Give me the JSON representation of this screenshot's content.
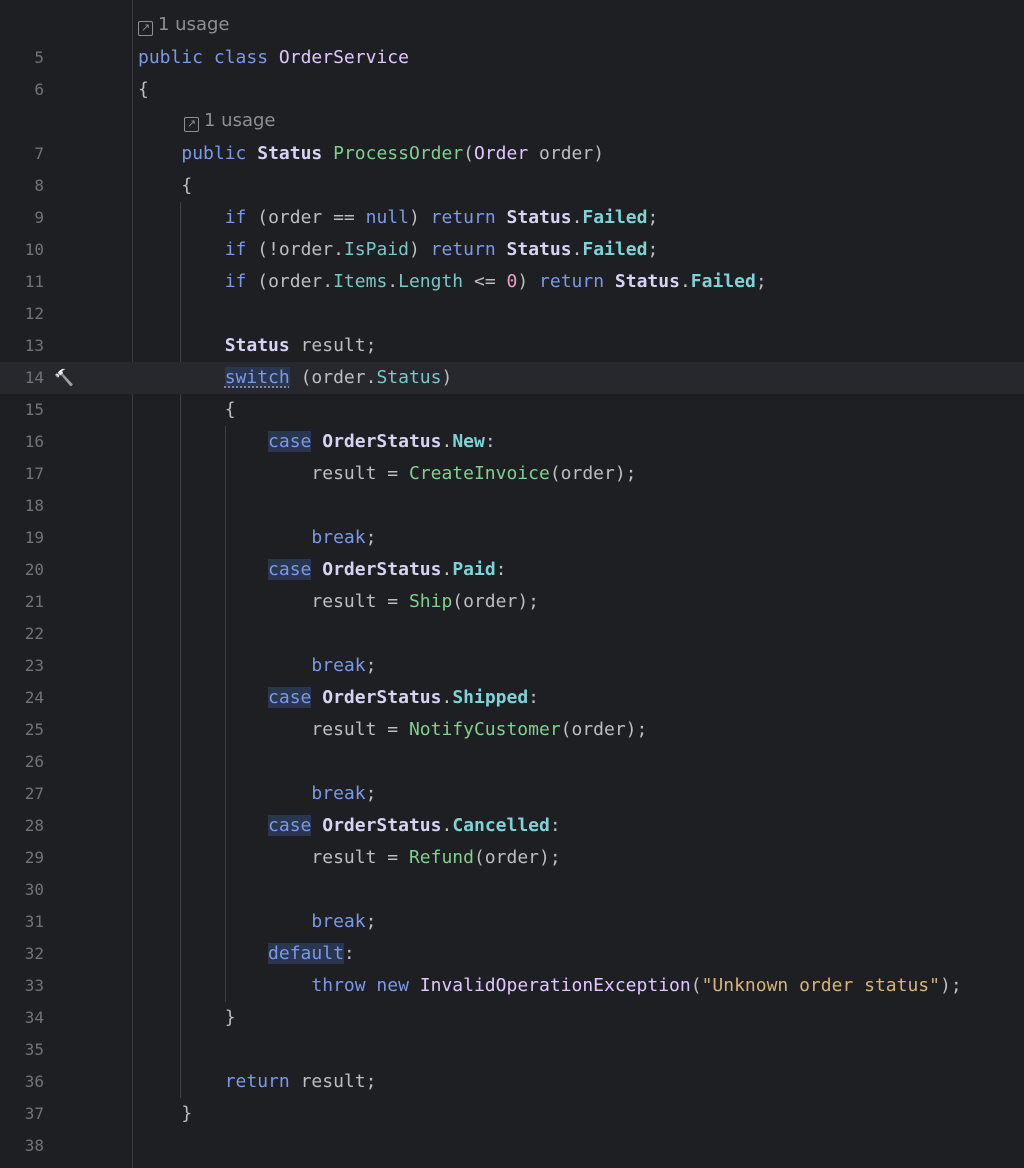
{
  "editor": {
    "usage_hints": [
      "1 usage",
      "1 usage"
    ],
    "gutter_icon": "hammer-icon",
    "lines": [
      {
        "n": "5",
        "tokens": [
          [
            "kw",
            "public"
          ],
          [
            "p",
            " "
          ],
          [
            "kw",
            "class"
          ],
          [
            "p",
            " "
          ],
          [
            "cls",
            "OrderService"
          ]
        ]
      },
      {
        "n": "6",
        "tokens": [
          [
            "p",
            "{"
          ]
        ]
      },
      {
        "n": "7",
        "tokens": [
          [
            "p",
            "    "
          ],
          [
            "kw",
            "public"
          ],
          [
            "p",
            " "
          ],
          [
            "typ",
            "Status"
          ],
          [
            "p",
            " "
          ],
          [
            "mfn",
            "ProcessOrder"
          ],
          [
            "p",
            "("
          ],
          [
            "cls",
            "Order"
          ],
          [
            "p",
            " order)"
          ]
        ]
      },
      {
        "n": "8",
        "tokens": [
          [
            "p",
            "    {"
          ]
        ]
      },
      {
        "n": "9",
        "tokens": [
          [
            "p",
            "        "
          ],
          [
            "kw",
            "if"
          ],
          [
            "p",
            " (order == "
          ],
          [
            "kw",
            "null"
          ],
          [
            "p",
            ") "
          ],
          [
            "kw",
            "return"
          ],
          [
            "p",
            " "
          ],
          [
            "typ",
            "Status"
          ],
          [
            "p",
            "."
          ],
          [
            "enm",
            "Failed"
          ],
          [
            "p",
            ";"
          ]
        ]
      },
      {
        "n": "10",
        "tokens": [
          [
            "p",
            "        "
          ],
          [
            "kw",
            "if"
          ],
          [
            "p",
            " (!order."
          ],
          [
            "prop",
            "IsPaid"
          ],
          [
            "p",
            ") "
          ],
          [
            "kw",
            "return"
          ],
          [
            "p",
            " "
          ],
          [
            "typ",
            "Status"
          ],
          [
            "p",
            "."
          ],
          [
            "enm",
            "Failed"
          ],
          [
            "p",
            ";"
          ]
        ]
      },
      {
        "n": "11",
        "tokens": [
          [
            "p",
            "        "
          ],
          [
            "kw",
            "if"
          ],
          [
            "p",
            " (order."
          ],
          [
            "prop",
            "Items"
          ],
          [
            "p",
            "."
          ],
          [
            "prop",
            "Length"
          ],
          [
            "p",
            " <= "
          ],
          [
            "num",
            "0"
          ],
          [
            "p",
            ") "
          ],
          [
            "kw",
            "return"
          ],
          [
            "p",
            " "
          ],
          [
            "typ",
            "Status"
          ],
          [
            "p",
            "."
          ],
          [
            "enm",
            "Failed"
          ],
          [
            "p",
            ";"
          ]
        ]
      },
      {
        "n": "12",
        "tokens": []
      },
      {
        "n": "13",
        "tokens": [
          [
            "p",
            "        "
          ],
          [
            "typ",
            "Status"
          ],
          [
            "p",
            " result;"
          ]
        ]
      },
      {
        "n": "14",
        "tokens": [
          [
            "p",
            "        "
          ],
          [
            "sw kw",
            "switch"
          ],
          [
            "p",
            " (order."
          ],
          [
            "prop",
            "Status"
          ],
          [
            "p",
            ")"
          ]
        ]
      },
      {
        "n": "15",
        "tokens": [
          [
            "p",
            "        {"
          ]
        ]
      },
      {
        "n": "16",
        "tokens": [
          [
            "p",
            "            "
          ],
          [
            "casebg kw",
            "case"
          ],
          [
            "p",
            " "
          ],
          [
            "typ",
            "OrderStatus"
          ],
          [
            "p",
            "."
          ],
          [
            "enm",
            "New"
          ],
          [
            "p",
            ":"
          ]
        ]
      },
      {
        "n": "17",
        "tokens": [
          [
            "p",
            "                result = "
          ],
          [
            "mfn",
            "CreateInvoice"
          ],
          [
            "p",
            "(order);"
          ]
        ]
      },
      {
        "n": "18",
        "tokens": []
      },
      {
        "n": "19",
        "tokens": [
          [
            "p",
            "                "
          ],
          [
            "kw",
            "break"
          ],
          [
            "p",
            ";"
          ]
        ]
      },
      {
        "n": "20",
        "tokens": [
          [
            "p",
            "            "
          ],
          [
            "casebg kw",
            "case"
          ],
          [
            "p",
            " "
          ],
          [
            "typ",
            "OrderStatus"
          ],
          [
            "p",
            "."
          ],
          [
            "enm",
            "Paid"
          ],
          [
            "p",
            ":"
          ]
        ]
      },
      {
        "n": "21",
        "tokens": [
          [
            "p",
            "                result = "
          ],
          [
            "mfn",
            "Ship"
          ],
          [
            "p",
            "(order);"
          ]
        ]
      },
      {
        "n": "22",
        "tokens": []
      },
      {
        "n": "23",
        "tokens": [
          [
            "p",
            "                "
          ],
          [
            "kw",
            "break"
          ],
          [
            "p",
            ";"
          ]
        ]
      },
      {
        "n": "24",
        "tokens": [
          [
            "p",
            "            "
          ],
          [
            "casebg kw",
            "case"
          ],
          [
            "p",
            " "
          ],
          [
            "typ",
            "OrderStatus"
          ],
          [
            "p",
            "."
          ],
          [
            "enm",
            "Shipped"
          ],
          [
            "p",
            ":"
          ]
        ]
      },
      {
        "n": "25",
        "tokens": [
          [
            "p",
            "                result = "
          ],
          [
            "mfn",
            "NotifyCustomer"
          ],
          [
            "p",
            "(order);"
          ]
        ]
      },
      {
        "n": "26",
        "tokens": []
      },
      {
        "n": "27",
        "tokens": [
          [
            "p",
            "                "
          ],
          [
            "kw",
            "break"
          ],
          [
            "p",
            ";"
          ]
        ]
      },
      {
        "n": "28",
        "tokens": [
          [
            "p",
            "            "
          ],
          [
            "casebg kw",
            "case"
          ],
          [
            "p",
            " "
          ],
          [
            "typ",
            "OrderStatus"
          ],
          [
            "p",
            "."
          ],
          [
            "enm",
            "Cancelled"
          ],
          [
            "p",
            ":"
          ]
        ]
      },
      {
        "n": "29",
        "tokens": [
          [
            "p",
            "                result = "
          ],
          [
            "mfn",
            "Refund"
          ],
          [
            "p",
            "(order);"
          ]
        ]
      },
      {
        "n": "30",
        "tokens": []
      },
      {
        "n": "31",
        "tokens": [
          [
            "p",
            "                "
          ],
          [
            "kw",
            "break"
          ],
          [
            "p",
            ";"
          ]
        ]
      },
      {
        "n": "32",
        "tokens": [
          [
            "p",
            "            "
          ],
          [
            "casebg kw",
            "default"
          ],
          [
            "p",
            ":"
          ]
        ]
      },
      {
        "n": "33",
        "tokens": [
          [
            "p",
            "                "
          ],
          [
            "kw",
            "throw"
          ],
          [
            "p",
            " "
          ],
          [
            "kw",
            "new"
          ],
          [
            "p",
            " "
          ],
          [
            "cls",
            "InvalidOperationException"
          ],
          [
            "p",
            "("
          ],
          [
            "str",
            "\"Unknown order status\""
          ],
          [
            "p",
            ");"
          ]
        ]
      },
      {
        "n": "34",
        "tokens": [
          [
            "p",
            "        }"
          ]
        ]
      },
      {
        "n": "35",
        "tokens": []
      },
      {
        "n": "36",
        "tokens": [
          [
            "p",
            "        "
          ],
          [
            "kw",
            "return"
          ],
          [
            "p",
            " result;"
          ]
        ]
      },
      {
        "n": "37",
        "tokens": [
          [
            "p",
            "    }"
          ]
        ]
      },
      {
        "n": "38",
        "tokens": []
      }
    ]
  }
}
